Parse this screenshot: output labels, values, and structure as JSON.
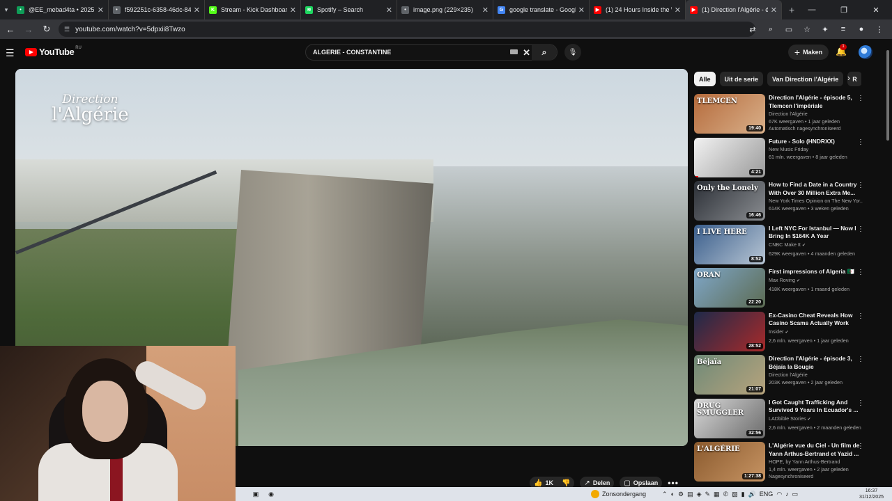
{
  "browser": {
    "tabs": [
      {
        "title": "@EE_mebad4ta • 2025 K",
        "color": "#0f9d58",
        "glyph": "•"
      },
      {
        "title": "f592251c-6358-46dc-846",
        "color": "#5f6368",
        "glyph": "•"
      },
      {
        "title": "Stream - Kick Dashboard",
        "color": "#53fc18",
        "glyph": "K"
      },
      {
        "title": "Spotify – Search",
        "color": "#1ed760",
        "glyph": "≋"
      },
      {
        "title": "image.png (229×235)",
        "color": "#5f6368",
        "glyph": "•"
      },
      {
        "title": "google translate - Googl",
        "color": "#4285f4",
        "glyph": "G"
      },
      {
        "title": "(1) 24 Hours Inside the W",
        "color": "#ff0000",
        "glyph": "▶"
      },
      {
        "title": "(1) Direction l'Algérie - é",
        "color": "#ff0000",
        "glyph": "▶"
      }
    ],
    "new_tab": "+",
    "url": "youtube.com/watch?v=5dpxii8Twzo"
  },
  "youtube": {
    "logo_text": "YouTube",
    "country_code": "RU",
    "search_query": "ALGERIE - CONSTANTINE",
    "create_label": "Maken",
    "notification_count": "1"
  },
  "video": {
    "overlay_brand_line1": "Direction",
    "overlay_brand_line2": "l'Algérie",
    "actions": {
      "likes": "1K",
      "share": "Delen",
      "save": "Opslaan"
    }
  },
  "chips": [
    "Alle",
    "Uit de serie",
    "Van Direction l'Algérie",
    "R"
  ],
  "recommendations": [
    {
      "title": "Direction l'Algérie - épisode 5, Tlemcen l'impériale",
      "channel": "Direction l'Algérie",
      "verified": false,
      "views": "67K weergaven • 1 jaar geleden",
      "badge": "Automatisch nagesynchroniseerd",
      "duration": "19:40",
      "thumb_text": "TLEMCEN",
      "colors": [
        "#b56b3c",
        "#d9b08a"
      ],
      "progress": 0
    },
    {
      "title": "Future - Solo (HNDRXX)",
      "channel": "New Music Friday",
      "verified": false,
      "views": "61 mln. weergaven • 8 jaar geleden",
      "badge": "",
      "duration": "4:21",
      "thumb_text": "",
      "colors": [
        "#f2f2f2",
        "#9a9a9a"
      ],
      "progress": 0.06
    },
    {
      "title": "How to Find a Date in a Country With Over 30 Million Extra Me...",
      "channel": "New York Times Opinion on The New Yor...",
      "verified": false,
      "views": "614K weergaven • 3 weken geleden",
      "badge": "",
      "duration": "16:46",
      "thumb_text": "Only the Lonely",
      "colors": [
        "#2b2f36",
        "#8a8d91"
      ],
      "progress": 0
    },
    {
      "title": "I Left NYC For Istanbul — Now I Bring In $164K A Year",
      "channel": "CNBC Make It",
      "verified": true,
      "views": "629K weergaven • 4 maanden geleden",
      "badge": "",
      "duration": "8:52",
      "thumb_text": "I LIVE HERE",
      "colors": [
        "#3a5e8c",
        "#b8c6d4"
      ],
      "progress": 0
    },
    {
      "title": "First impressions of Algeria 🇩🇿",
      "channel": "Max Roving",
      "verified": true,
      "views": "418K weergaven • 1 maand geleden",
      "badge": "",
      "duration": "22:20",
      "thumb_text": "ORAN",
      "colors": [
        "#7fa7c9",
        "#5c6b52"
      ],
      "progress": 0
    },
    {
      "title": "Ex-Casino Cheat Reveals How Casino Scams Actually Work",
      "channel": "Insider",
      "verified": true,
      "views": "2,6 mln. weergaven • 1 jaar geleden",
      "badge": "",
      "duration": "28:52",
      "thumb_text": "",
      "colors": [
        "#1e2a4a",
        "#a82a2a"
      ],
      "progress": 0
    },
    {
      "title": "Direction l'Algérie - épisode 3, Béjaïa la Bougie",
      "channel": "Direction l'Algérie",
      "verified": false,
      "views": "203K weergaven • 2 jaar geleden",
      "badge": "",
      "duration": "21:07",
      "thumb_text": "Béjaïa",
      "colors": [
        "#6f8a78",
        "#b7a37c"
      ],
      "progress": 0
    },
    {
      "title": "I Got Caught Trafficking And Survived 9 Years In Ecuador's ...",
      "channel": "LADbible Stories",
      "verified": true,
      "views": "2,6 mln. weergaven • 2 maanden geleden",
      "badge": "",
      "duration": "32:56",
      "thumb_text": "DRUG SMUGGLER",
      "colors": [
        "#d9d9d9",
        "#6b6b6b"
      ],
      "progress": 0
    },
    {
      "title": "L'Algérie vue du Ciel - Un film de Yann Arthus-Bertrand et Yazid ...",
      "channel": "HOPE, by Yann Arthus-Bertrand",
      "verified": false,
      "views": "1,4 mln. weergaven • 2 jaar geleden",
      "badge": "Nagesynchroniseerd",
      "duration": "1:27:38",
      "thumb_text": "L'ALGÉRIE",
      "colors": [
        "#8a5a2e",
        "#c79463"
      ],
      "progress": 0
    }
  ],
  "taskbar": {
    "weather": "Zonsondergang",
    "lang": "ENG",
    "time": "16:37",
    "date": "31/12/2025"
  }
}
